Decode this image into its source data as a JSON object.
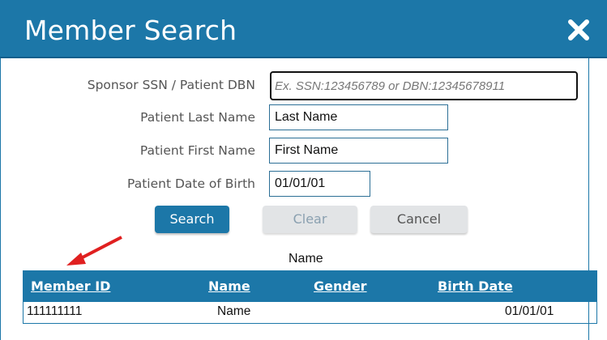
{
  "dialog": {
    "title": "Member Search",
    "close_icon": "close-icon"
  },
  "form": {
    "ssn_label": "Sponsor SSN / Patient DBN",
    "ssn_placeholder": "Ex. SSN:123456789 or DBN:12345678911",
    "last_name_label": "Patient Last Name",
    "last_name_value": "Last Name",
    "first_name_label": "Patient First Name",
    "first_name_value": "First Name",
    "dob_label": "Patient Date of Birth",
    "dob_value": "01/01/01"
  },
  "buttons": {
    "search": "Search",
    "clear": "Clear",
    "cancel": "Cancel"
  },
  "results": {
    "caption": "Name",
    "columns": [
      "Member ID",
      "Name",
      "Gender",
      "Birth Date"
    ],
    "rows": [
      {
        "member_id": "111111111",
        "name": "Name",
        "gender": "",
        "birth_date": "01/01/01"
      }
    ]
  },
  "colors": {
    "accent": "#1c77a8",
    "annotation_arrow": "#e02020"
  }
}
